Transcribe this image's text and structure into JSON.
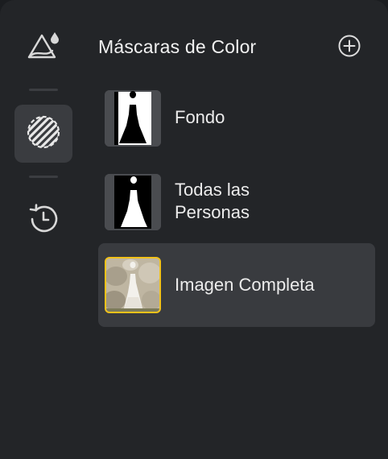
{
  "sidebar": {
    "items": [
      {
        "name": "adjust",
        "icon": "triangle-droplet-icon"
      },
      {
        "name": "masks",
        "icon": "striped-circle-icon",
        "active": true
      },
      {
        "name": "history",
        "icon": "history-icon"
      }
    ]
  },
  "panel": {
    "title": "Máscaras de Color",
    "add_icon": "plus-circle-icon"
  },
  "masks": [
    {
      "label_lines": [
        "Fondo"
      ],
      "thumbnail": "background-mask",
      "selected": false
    },
    {
      "label_lines": [
        "Todas las",
        "Personas"
      ],
      "thumbnail": "people-mask",
      "selected": false
    },
    {
      "label_lines": [
        "Imagen Completa"
      ],
      "thumbnail": "photo",
      "selected": true
    }
  ],
  "colors": {
    "panel_bg": "#232528",
    "selected_bg": "#393b3f",
    "selected_border": "#f2c21a",
    "text": "#ececec"
  }
}
